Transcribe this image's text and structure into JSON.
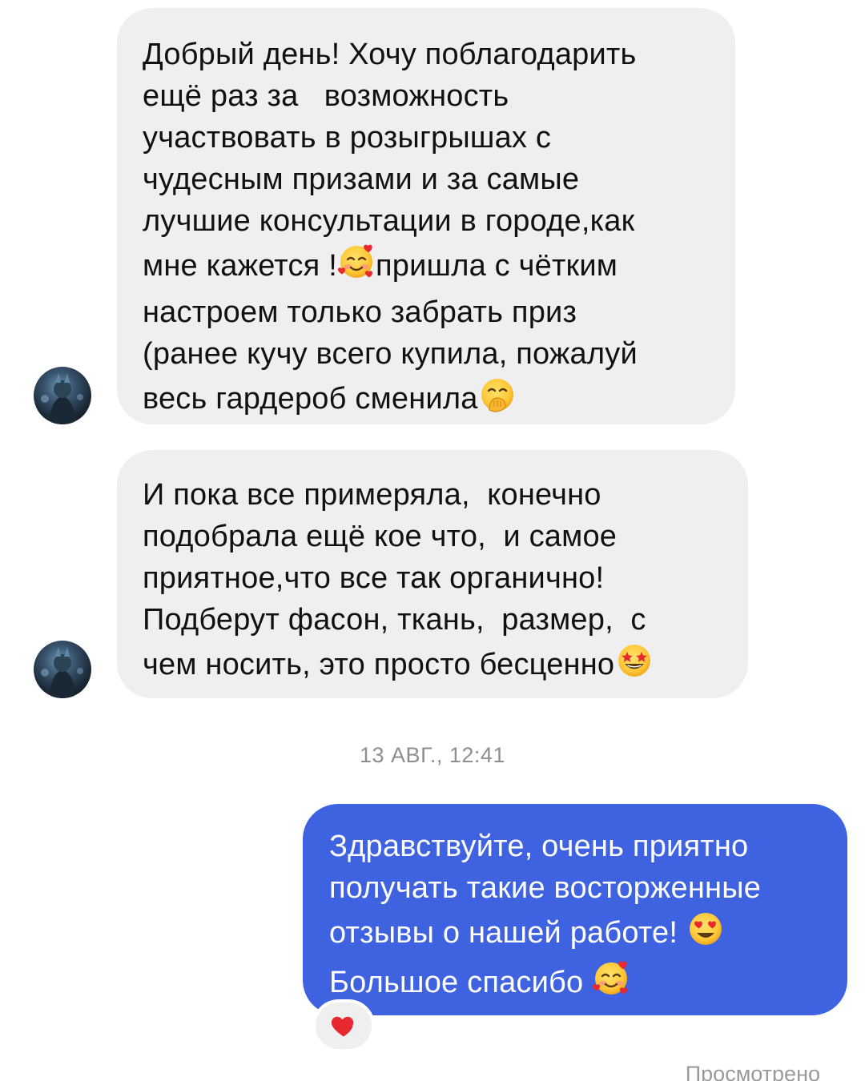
{
  "messages": [
    {
      "id": "msg1",
      "direction": "incoming",
      "lines": [
        "Добрый день! Хочу поблагодарить",
        "ещё раз за   возможность",
        "участвовать в розыгрышах с",
        "чудесным призами и за самые",
        "лучшие консультации в городе,как",
        "мне кажется !",
        "пришла с чётким",
        "настроем только забрать приз",
        "(ранее кучу всего купила, пожалуй",
        "весь гардероб сменила"
      ],
      "emojis": [
        "smiling-face-with-hearts",
        "face-with-hand-over-mouth"
      ]
    },
    {
      "id": "msg2",
      "direction": "incoming",
      "lines": [
        "И пока все примеряла,  конечно",
        "подобрала ещё кое что,  и самое",
        "приятное,что все так органично!",
        "Подберут фасон, ткань,  размер,  с",
        "чем носить, это просто бесценно"
      ],
      "emojis": [
        "star-struck"
      ]
    },
    {
      "id": "msg3",
      "direction": "outgoing",
      "lines": [
        "Здравствуйте, очень приятно",
        "получать такие восторженные",
        "отзывы о нашей работе!",
        "Большое спасибо"
      ],
      "emojis": [
        "heart-eyes",
        "smiling-face-with-hearts"
      ],
      "reaction": "red-heart"
    }
  ],
  "timestamp": "13 АВГ., 12:41",
  "status": "Просмотрено",
  "colors": {
    "incoming_bubble": "#efefef",
    "outgoing_bubble": "#3e62e0",
    "timestamp_text": "#8e8e8e",
    "reaction_heart": "#e8282f"
  }
}
